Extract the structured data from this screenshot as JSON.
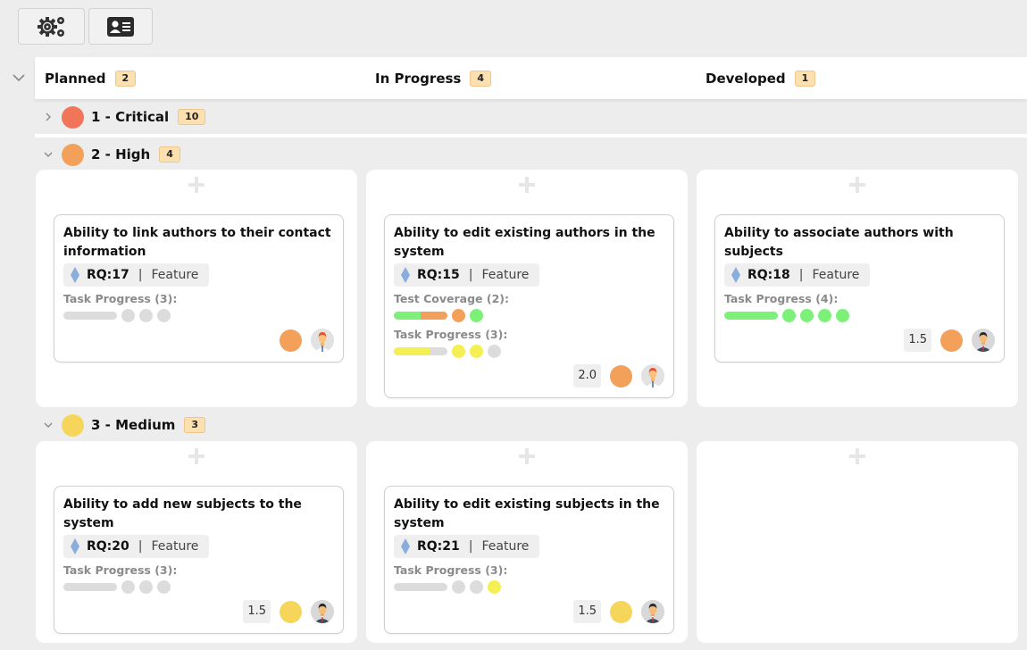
{
  "toolbar": {
    "buttons": [
      {
        "name": "settings",
        "icon": "gears-icon"
      },
      {
        "name": "contact-card",
        "icon": "id-card-icon"
      }
    ]
  },
  "columns": [
    {
      "label": "Planned",
      "count": "2"
    },
    {
      "label": "In Progress",
      "count": "4"
    },
    {
      "label": "Developed",
      "count": "1"
    }
  ],
  "colors": {
    "critical": "#f07559",
    "high": "#f2a05a",
    "medium": "#f5d65a",
    "green": "#7df07a",
    "orange": "#f2a05a",
    "yellow": "#f3ef55",
    "grey": "#dcdcdc",
    "diamond": "#8aaedb"
  },
  "swimlanes": [
    {
      "label": "1 - Critical",
      "count": "10",
      "color": "#f07559",
      "expanded": false
    },
    {
      "label": "2 - High",
      "count": "4",
      "color": "#f2a05a",
      "expanded": true,
      "cells": [
        {
          "cards": [
            {
              "title": "Ability to link authors to their contact information",
              "rq": "RQ:17",
              "sep": "|",
              "type": "Feature",
              "test_coverage": null,
              "task_progress": {
                "label": "Task Progress (3):",
                "done_fraction": 0,
                "dots": [
                  "grey",
                  "grey",
                  "grey"
                ]
              },
              "estimate": null,
              "priority_color": "#f2a05a",
              "avatar": "redhead-man"
            }
          ]
        },
        {
          "cards": [
            {
              "title": "Ability to edit existing authors in the system",
              "rq": "RQ:15",
              "sep": "|",
              "type": "Feature",
              "test_coverage": {
                "label": "Test Coverage (2):",
                "segments": [
                  {
                    "color": "green",
                    "fraction": 0.5
                  },
                  {
                    "color": "orange",
                    "fraction": 0.5
                  }
                ],
                "dots": [
                  "orange",
                  "green"
                ]
              },
              "task_progress": {
                "label": "Task Progress (3):",
                "segments": [
                  {
                    "color": "yellow",
                    "fraction": 0.67
                  }
                ],
                "dots": [
                  "yellow",
                  "yellow",
                  "grey"
                ]
              },
              "estimate": "2.0",
              "priority_color": "#f2a05a",
              "avatar": "redhead-man"
            }
          ]
        },
        {
          "cards": [
            {
              "title": "Ability to associate authors with subjects",
              "rq": "RQ:18",
              "sep": "|",
              "type": "Feature",
              "test_coverage": null,
              "task_progress": {
                "label": "Task Progress (4):",
                "segments": [
                  {
                    "color": "green",
                    "fraction": 1.0
                  }
                ],
                "dots": [
                  "green",
                  "green",
                  "green",
                  "green"
                ]
              },
              "estimate": "1.5",
              "priority_color": "#f2a05a",
              "avatar": "dark-hair-man"
            }
          ]
        }
      ]
    },
    {
      "label": "3 - Medium",
      "count": "3",
      "color": "#f5d65a",
      "expanded": true,
      "cells": [
        {
          "cards": [
            {
              "title": "Ability to add new subjects to the system",
              "rq": "RQ:20",
              "sep": "|",
              "type": "Feature",
              "test_coverage": null,
              "task_progress": {
                "label": "Task Progress (3):",
                "segments": [],
                "dots": [
                  "grey",
                  "grey",
                  "grey"
                ]
              },
              "estimate": "1.5",
              "priority_color": "#f5d65a",
              "avatar": "dark-hair-man"
            }
          ]
        },
        {
          "cards": [
            {
              "title": "Ability to edit existing subjects in the system",
              "rq": "RQ:21",
              "sep": "|",
              "type": "Feature",
              "test_coverage": null,
              "task_progress": {
                "label": "Task Progress (3):",
                "segments": [],
                "dots": [
                  "grey",
                  "grey",
                  "yellow"
                ]
              },
              "estimate": "1.5",
              "priority_color": "#f5d65a",
              "avatar": "dark-hair-man"
            }
          ]
        },
        {
          "cards": []
        }
      ]
    }
  ]
}
